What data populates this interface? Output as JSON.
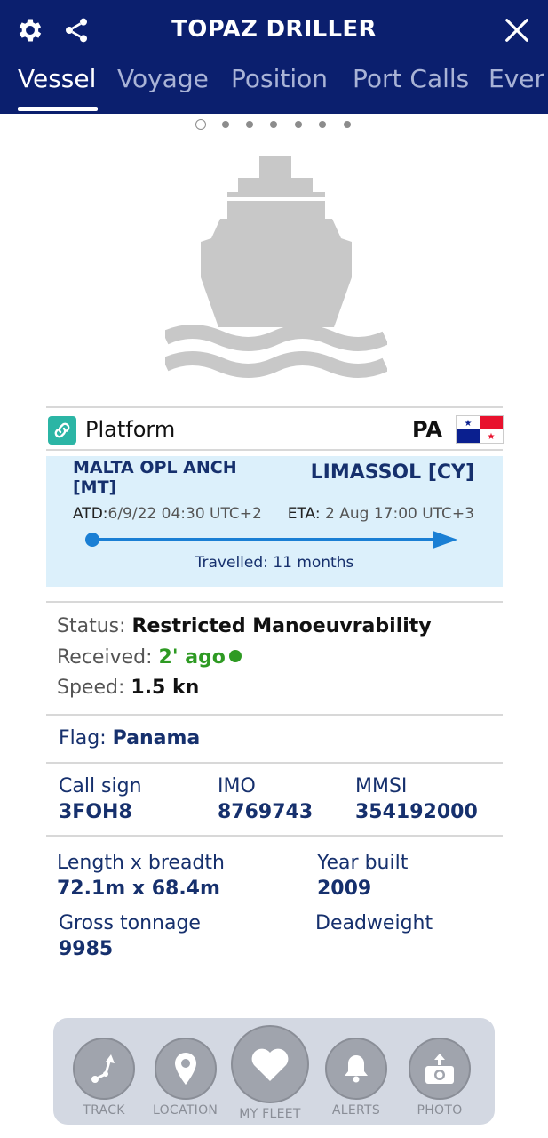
{
  "header": {
    "title": "TOPAZ DRILLER",
    "tabs": [
      "Vessel",
      "Voyage",
      "Position",
      "Port Calls",
      "Ever"
    ]
  },
  "pager": {
    "count": 7,
    "current": 1
  },
  "vessel_type": {
    "label": "Platform",
    "flag_code": "PA"
  },
  "voyage": {
    "from": "MALTA OPL ANCH [MT]",
    "to": "LIMASSOL [CY]",
    "atd_label": "ATD:",
    "atd_value": "6/9/22 04:30 UTC+2",
    "eta_label": "ETA:",
    "eta_value": "2 Aug 17:00 UTC+3",
    "travelled": "Travelled: 11 months",
    "progress_fraction": 0.97
  },
  "status": {
    "status_label": "Status:",
    "status_value": "Restricted Manoeuvrability",
    "received_label": "Received:",
    "received_value": "2' ago",
    "speed_label": "Speed:",
    "speed_value": "1.5 kn"
  },
  "flag": {
    "label": "Flag:",
    "value": "Panama"
  },
  "ids": {
    "call_sign_label": "Call sign",
    "call_sign_value": "3FOH8",
    "imo_label": "IMO",
    "imo_value": "8769743",
    "mmsi_label": "MMSI",
    "mmsi_value": "354192000"
  },
  "dimensions": {
    "length_label": "Length x breadth",
    "length_value": "72.1m x 68.4m",
    "year_label": "Year built",
    "year_value": "2009",
    "gross_label": "Gross tonnage",
    "gross_value": "9985",
    "deadweight_label": "Deadweight",
    "deadweight_value": ""
  },
  "bottom_nav": {
    "track": "TRACK",
    "location": "LOCATION",
    "my_fleet": "MY FLEET",
    "alerts": "ALERTS",
    "photo": "PHOTO"
  },
  "colors": {
    "header_bg": "#0b1f6e",
    "accent_text": "#16306d",
    "voyage_bg": "#dcf0fb",
    "progress": "#1a7fd4",
    "online_green": "#2e9a23",
    "type_icon": "#2bb5a5"
  },
  "icons": {
    "settings": "gear-icon",
    "share": "share-icon",
    "close": "close-icon",
    "type": "link-icon"
  }
}
